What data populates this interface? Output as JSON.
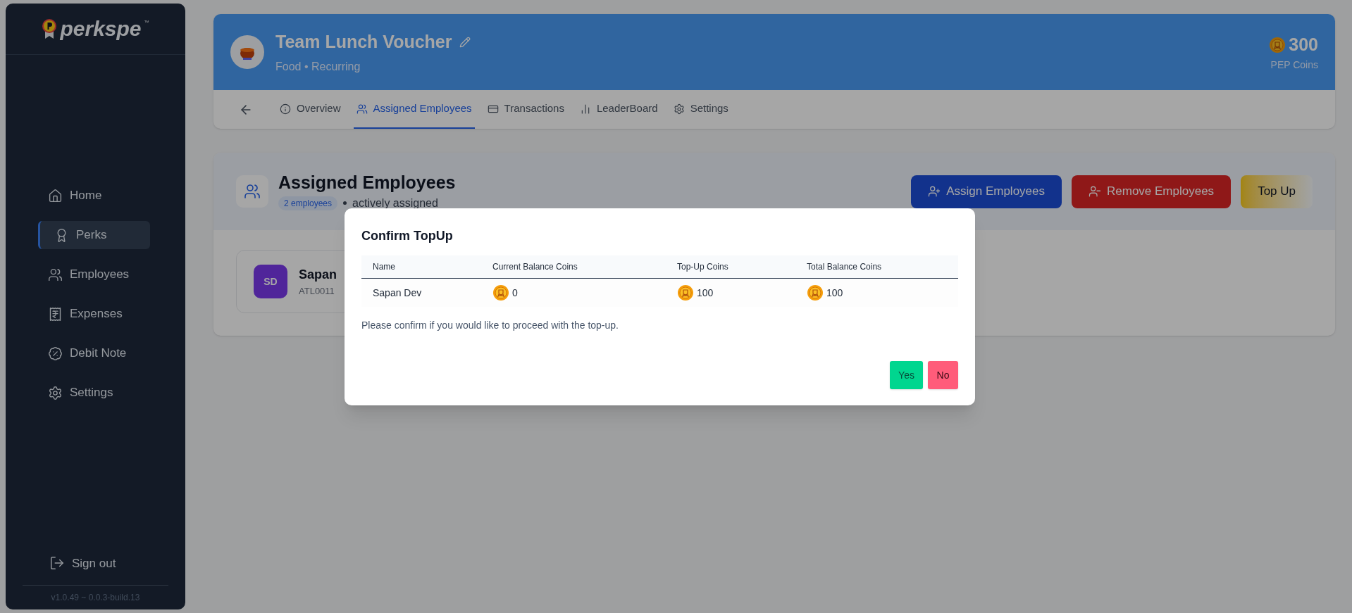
{
  "sidebar": {
    "logo": {
      "wordmark": "perkspe",
      "mark": "™"
    },
    "items": [
      {
        "label": "Home",
        "selected": false
      },
      {
        "label": "Perks",
        "selected": true
      },
      {
        "label": "Employees",
        "selected": false
      },
      {
        "label": "Expenses",
        "selected": false
      },
      {
        "label": "Debit Note",
        "selected": false
      },
      {
        "label": "Settings",
        "selected": false
      }
    ],
    "sign_out": "Sign out",
    "version": "v1.0.49 ~ 0.0.3-build.13"
  },
  "perk": {
    "title": "Team Lunch Voucher",
    "subtitle": "Food • Recurring",
    "coins": "300",
    "coins_label": "PEP Coins"
  },
  "tabs": [
    {
      "label": "Overview",
      "selected": false
    },
    {
      "label": "Assigned Employees",
      "selected": true
    },
    {
      "label": "Transactions",
      "selected": false
    },
    {
      "label": "LeaderBoard",
      "selected": false
    },
    {
      "label": "Settings",
      "selected": false
    }
  ],
  "section": {
    "title": "Assigned Employees",
    "badge": "2 employees",
    "status": "actively assigned",
    "buttons": [
      {
        "label": "Assign Employees",
        "kind": "assign"
      },
      {
        "label": "Remove Employees",
        "kind": "remove"
      },
      {
        "label": "Top Up",
        "kind": "topup"
      }
    ]
  },
  "employees": [
    {
      "initials": "SD",
      "name": "Sapan",
      "code": "ATL0011"
    }
  ],
  "dialog": {
    "title": "Confirm TopUp",
    "columns": [
      "Name",
      "Current Balance Coins",
      "Top-Up Coins",
      "Total Balance Coins"
    ],
    "rows": [
      {
        "name": "Sapan Dev",
        "current": "0",
        "topup": "100",
        "total": "100"
      }
    ],
    "message": "Please confirm if you would like to proceed with the top-up.",
    "buttons": [
      {
        "label": "Yes",
        "kind": "confirm"
      },
      {
        "label": "No",
        "kind": "cancel"
      }
    ]
  }
}
